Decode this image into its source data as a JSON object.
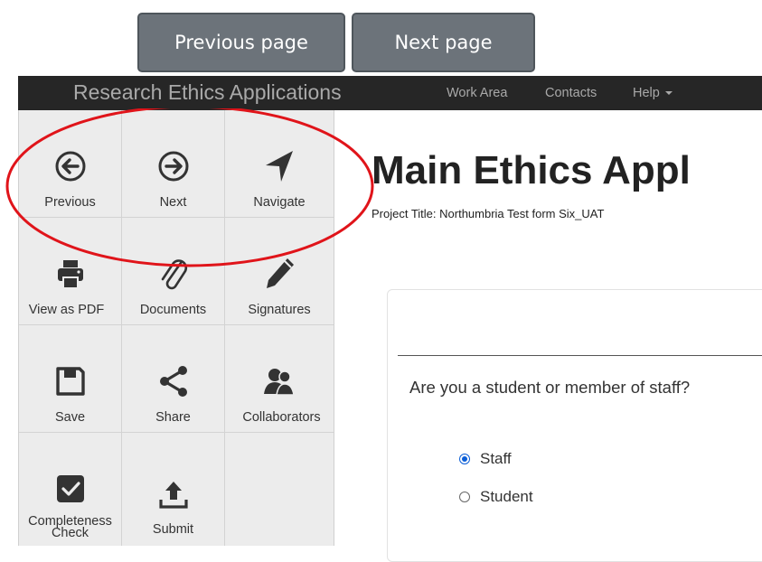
{
  "callouts": {
    "previous_page": "Previous page",
    "next_page": "Next page"
  },
  "navbar": {
    "brand": "Research Ethics Applications",
    "links": [
      "Work Area",
      "Contacts",
      "Help"
    ]
  },
  "toolbar": {
    "tiles": [
      {
        "label": "Previous",
        "icon": "arrow-left-circle-icon"
      },
      {
        "label": "Next",
        "icon": "arrow-right-circle-icon"
      },
      {
        "label": "Navigate",
        "icon": "location-arrow-icon"
      },
      {
        "label": "View as PDF",
        "icon": "printer-icon"
      },
      {
        "label": "Documents",
        "icon": "paperclip-icon"
      },
      {
        "label": "Signatures",
        "icon": "pencil-icon"
      },
      {
        "label": "Save",
        "icon": "floppy-disk-icon"
      },
      {
        "label": "Share",
        "icon": "share-icon"
      },
      {
        "label": "Collaborators",
        "icon": "users-icon"
      },
      {
        "label": "Completeness Check",
        "icon": "checkbox-icon"
      },
      {
        "label": "Submit",
        "icon": "upload-icon"
      }
    ]
  },
  "main": {
    "title": "Main Ethics Appl",
    "project_title": "Project Title: Northumbria Test form Six_UAT",
    "question": "Are you a student or member of staff?",
    "options": [
      {
        "label": "Staff",
        "selected": true
      },
      {
        "label": "Student",
        "selected": false
      }
    ]
  },
  "colors": {
    "navbar": "#262626",
    "callout_button": "#6c737a",
    "annotation": "#e0141a",
    "radio_selected": "#0b5ed7"
  }
}
